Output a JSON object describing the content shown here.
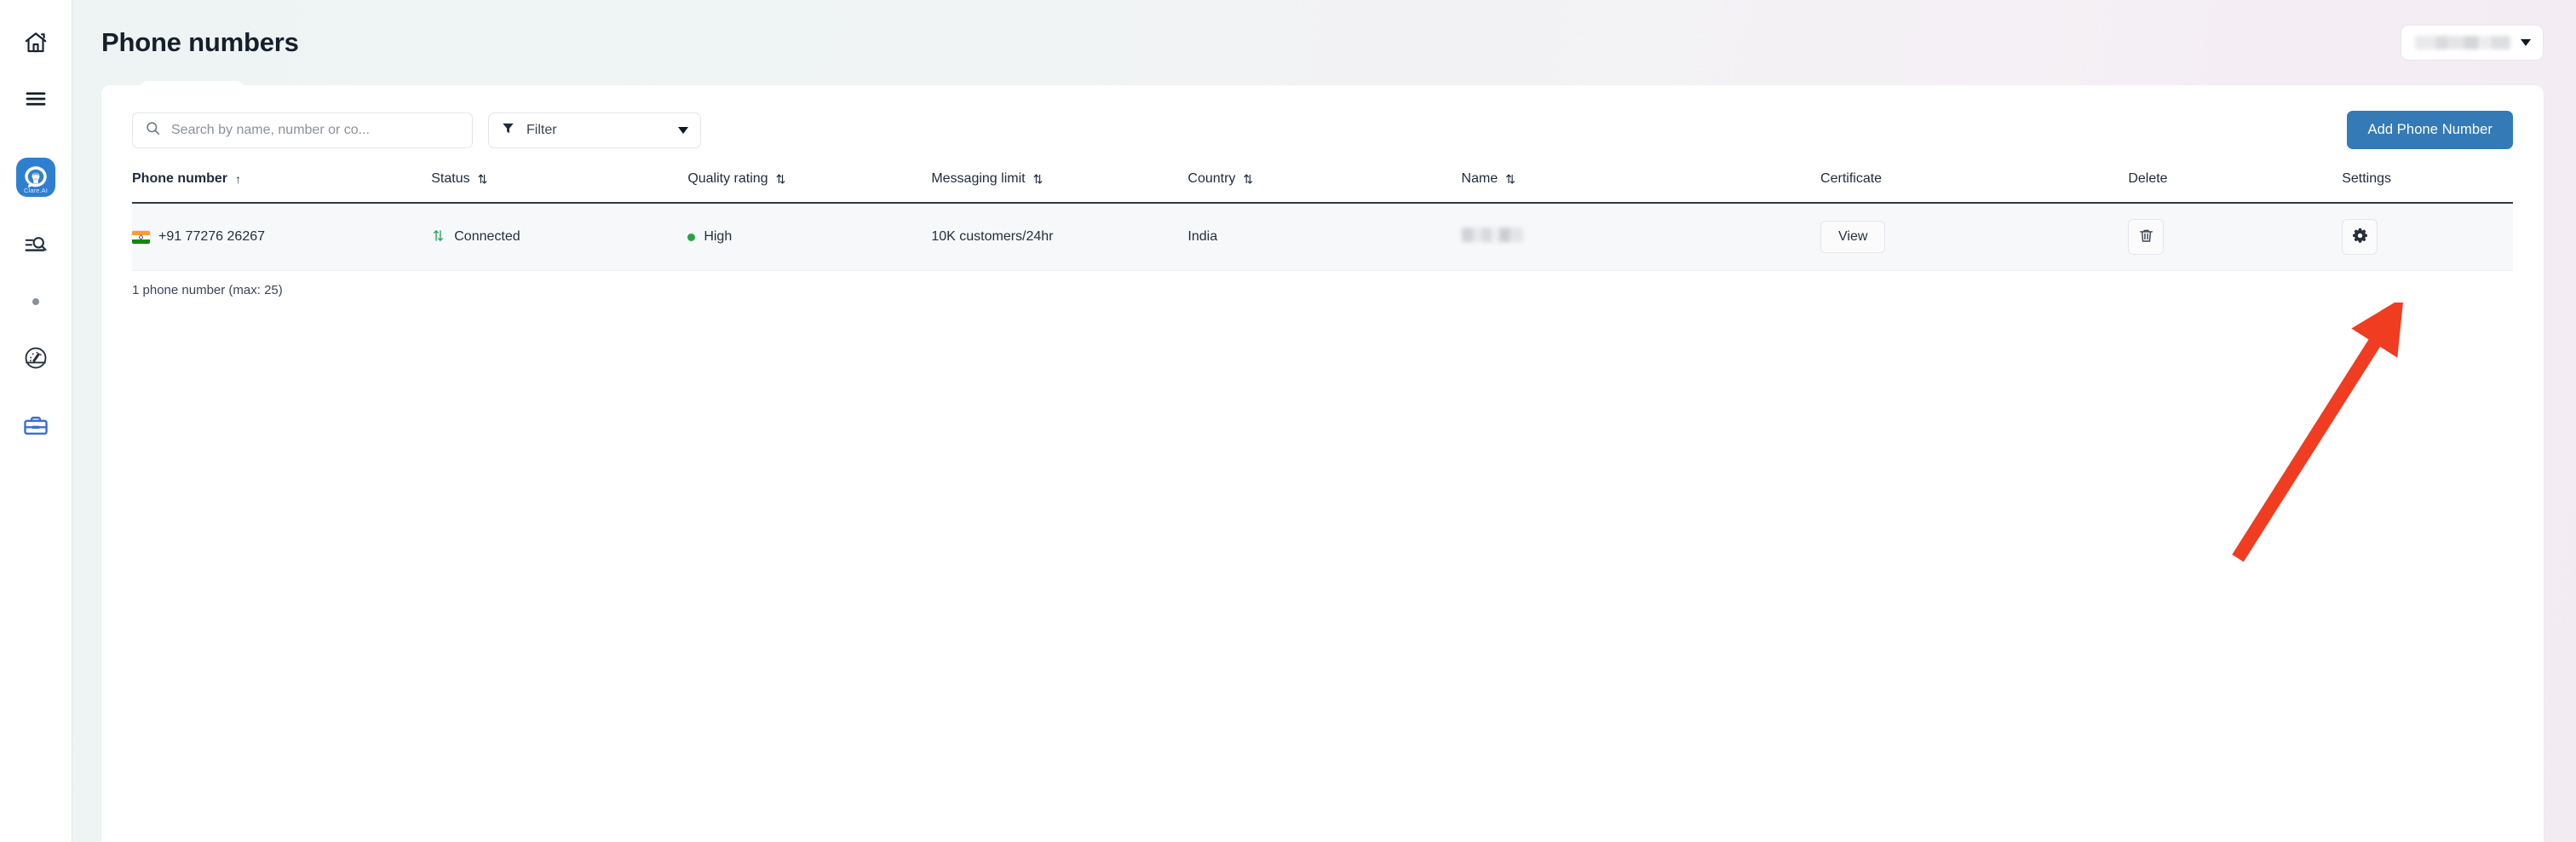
{
  "sidebar": {
    "items": [
      {
        "icon": "home-icon",
        "name": "home"
      },
      {
        "icon": "hamburger-menu-icon",
        "name": "menu"
      },
      {
        "icon": "clare-ai-logo",
        "name": "clare-ai",
        "label": "Clare.AI"
      },
      {
        "icon": "search-list-icon",
        "name": "search-list"
      },
      {
        "icon": "dot-icon",
        "name": "status-dot"
      },
      {
        "icon": "gauge-icon",
        "name": "performance"
      },
      {
        "icon": "briefcase-icon",
        "name": "workspace"
      }
    ]
  },
  "header": {
    "title": "Phone numbers",
    "account_chip": {
      "label": "",
      "redacted": true,
      "caret_icon": "chevron-down-icon"
    }
  },
  "toolbar": {
    "search": {
      "placeholder": "Search by name, number or co...",
      "value": "",
      "icon": "search-icon"
    },
    "filter": {
      "label": "Filter",
      "icon": "funnel-icon",
      "caret_icon": "chevron-down-icon"
    },
    "add_button": {
      "label": "Add Phone Number"
    }
  },
  "table": {
    "columns": [
      {
        "label": "Phone number",
        "sort": "asc",
        "sort_glyph": "↑",
        "active": true
      },
      {
        "label": "Status",
        "sort": "none",
        "sort_glyph": "⇅",
        "active": false
      },
      {
        "label": "Quality rating",
        "sort": "none",
        "sort_glyph": "⇅",
        "active": false
      },
      {
        "label": "Messaging limit",
        "sort": "none",
        "sort_glyph": "⇅",
        "active": false
      },
      {
        "label": "Country",
        "sort": "none",
        "sort_glyph": "⇅",
        "active": false
      },
      {
        "label": "Name",
        "sort": "none",
        "sort_glyph": "⇅",
        "active": false
      },
      {
        "label": "Certificate",
        "sort": null,
        "sort_glyph": "",
        "active": false
      },
      {
        "label": "Delete",
        "sort": null,
        "sort_glyph": "",
        "active": false
      },
      {
        "label": "Settings",
        "sort": null,
        "sort_glyph": "",
        "active": false
      }
    ],
    "rows": [
      {
        "phone_number": "+91 77276 26267",
        "phone_number_redacted": true,
        "country_flag": "india-flag-icon",
        "status": "Connected",
        "status_icon": "sync-arrows-icon",
        "quality_rating": "High",
        "quality_color": "#22a447",
        "messaging_limit": "10K customers/24hr",
        "country": "India",
        "name": "",
        "name_redacted": true,
        "certificate_button": "View",
        "delete_icon": "trash-icon",
        "settings_icon": "gear-icon"
      }
    ],
    "footnote": "1 phone number (max: 25)"
  },
  "annotation": {
    "type": "arrow",
    "color": "#f03c21",
    "points_to": "settings-gear-button"
  },
  "colors": {
    "accent": "#337ab7",
    "status_connected": "#26a65b",
    "quality_high": "#22a447",
    "annotation_red": "#f03c21",
    "page_bg_left": "#edf4f3",
    "page_bg_right": "#f3ebf2"
  }
}
